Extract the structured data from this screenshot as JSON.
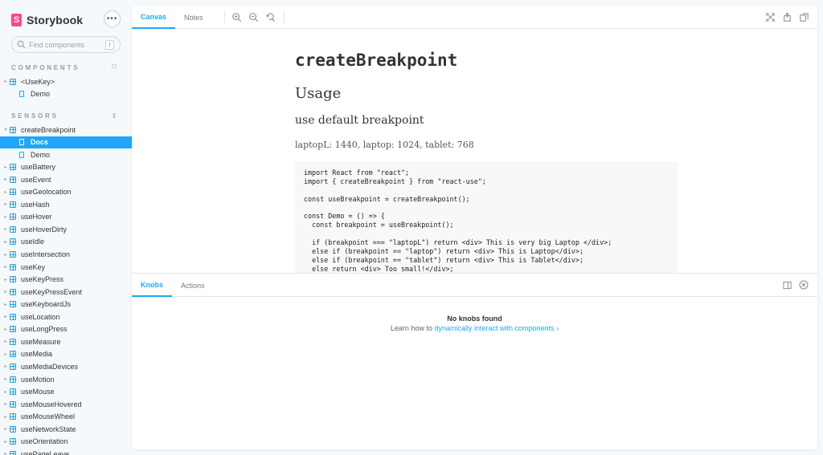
{
  "sidebar": {
    "brand": "Storybook",
    "brand_logo_letter": "S",
    "menu_label": "•••",
    "search_placeholder": "Find components",
    "search_shortcut": "/",
    "sections": [
      {
        "title": "COMPONENTS",
        "toggle": "⤧"
      },
      {
        "title": "SENSORS",
        "toggle": "⇕"
      }
    ],
    "components": [
      {
        "label": "<UseKey>",
        "type": "component"
      },
      {
        "label": "Demo",
        "type": "story"
      }
    ],
    "sensors": [
      {
        "label": "createBreakpoint",
        "type": "component",
        "expanded": true
      },
      {
        "label": "Docs",
        "type": "story",
        "selected": true
      },
      {
        "label": "Demo",
        "type": "story"
      },
      {
        "label": "useBattery",
        "type": "component"
      },
      {
        "label": "useEvent",
        "type": "component"
      },
      {
        "label": "useGeolocation",
        "type": "component"
      },
      {
        "label": "useHash",
        "type": "component"
      },
      {
        "label": "useHover",
        "type": "component"
      },
      {
        "label": "useHoverDirty",
        "type": "component"
      },
      {
        "label": "useIdle",
        "type": "component"
      },
      {
        "label": "useIntersection",
        "type": "component"
      },
      {
        "label": "useKey",
        "type": "component"
      },
      {
        "label": "useKeyPress",
        "type": "component"
      },
      {
        "label": "useKeyPressEvent",
        "type": "component"
      },
      {
        "label": "useKeyboardJs",
        "type": "component"
      },
      {
        "label": "useLocation",
        "type": "component"
      },
      {
        "label": "useLongPress",
        "type": "component"
      },
      {
        "label": "useMeasure",
        "type": "component"
      },
      {
        "label": "useMedia",
        "type": "component"
      },
      {
        "label": "useMediaDevices",
        "type": "component"
      },
      {
        "label": "useMotion",
        "type": "component"
      },
      {
        "label": "useMouse",
        "type": "component"
      },
      {
        "label": "useMouseHovered",
        "type": "component"
      },
      {
        "label": "useMouseWheel",
        "type": "component"
      },
      {
        "label": "useNetworkState",
        "type": "component"
      },
      {
        "label": "useOrientation",
        "type": "component"
      },
      {
        "label": "usePageLeave",
        "type": "component"
      }
    ]
  },
  "toolbar": {
    "tabs": [
      {
        "label": "Canvas",
        "active": true
      },
      {
        "label": "Notes",
        "active": false
      }
    ]
  },
  "doc": {
    "title": "createBreakpoint",
    "h2": "Usage",
    "h3": "use default breakpoint",
    "paragraph": "laptopL: 1440, laptop: 1024, tablet: 768",
    "code": [
      "import React from \"react\";",
      "import { createBreakpoint } from \"react-use\";",
      "",
      "const useBreakpoint = createBreakpoint();",
      "",
      "const Demo = () => {",
      "  const breakpoint = useBreakpoint();",
      "",
      "  if (breakpoint === \"laptopL\") return <div> This is very big Laptop </div>;",
      "  else if (breakpoint == \"laptop\") return <div> This is Laptop</div>;",
      "  else if (breakpoint == \"tablet\") return <div> This is Tablet</div>;",
      "  else return <div> Too small!</div>;",
      "};"
    ]
  },
  "addons": {
    "tabs": [
      {
        "label": "Knobs",
        "active": true
      },
      {
        "label": "Actions",
        "active": false
      }
    ],
    "empty_title": "No knobs found",
    "empty_text": "Learn how to ",
    "empty_link": "dynamically interact with components",
    "empty_link_chevron": "›"
  },
  "colors": {
    "accent": "#1ea7fd",
    "brand": "#ff4785",
    "component_icon": "#2d9cdb"
  }
}
